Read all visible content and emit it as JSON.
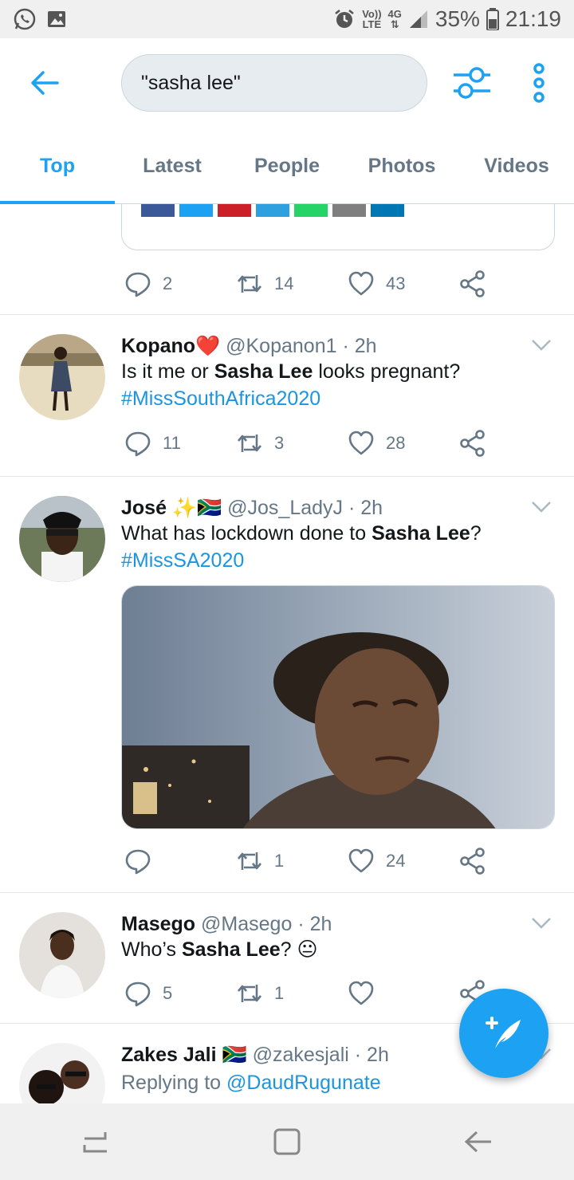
{
  "status_bar": {
    "network_top": "Vo))",
    "network_bottom": "LTE",
    "signal_type": "4G",
    "battery": "35%",
    "time": "21:19"
  },
  "search": {
    "query": "\"sasha lee\""
  },
  "tabs": [
    {
      "label": "Top",
      "active": true
    },
    {
      "label": "Latest",
      "active": false
    },
    {
      "label": "People",
      "active": false
    },
    {
      "label": "Photos",
      "active": false
    },
    {
      "label": "Videos",
      "active": false
    }
  ],
  "tweets": [
    {
      "replies": "2",
      "retweets": "14",
      "likes": "43"
    },
    {
      "name": "Kopano❤️",
      "handle": "@Kopanon1",
      "time": "· 2h",
      "text_before": "Is it me or ",
      "text_bold": "Sasha Lee",
      "text_after": " looks pregnant?",
      "hashtag": "#MissSouthAfrica2020",
      "replies": "11",
      "retweets": "3",
      "likes": "28"
    },
    {
      "name": "José ✨🇿🇦",
      "handle": "@Jos_LadyJ",
      "time": "· 2h",
      "text_before": "What has lockdown done to ",
      "text_bold": "Sasha Lee",
      "text_after": "?",
      "hashtag": "#MissSA2020",
      "replies": "",
      "retweets": "1",
      "likes": "24"
    },
    {
      "name": "Masego",
      "handle": "@Masego",
      "time": "· 2h",
      "text_before": "Who’s ",
      "text_bold": "Sasha Lee",
      "text_after": "? 😐",
      "replies": "5",
      "retweets": "1",
      "likes": ""
    },
    {
      "name": "Zakes Jali 🇿🇦",
      "handle": "@zakesjali",
      "time": "· 2h",
      "replying_prefix": "Replying to ",
      "replying_to": "@DaudRugunate"
    }
  ],
  "colors": {
    "accent": "#1da1f2",
    "hashtag": "#1b95e0",
    "muted": "#657786",
    "text": "#14171a"
  },
  "icons": [
    "back-arrow-icon",
    "filter-icon",
    "more-vertical-icon",
    "reply-icon",
    "retweet-icon",
    "like-icon",
    "share-icon",
    "chevron-down-icon",
    "compose-tweet-icon",
    "recent-apps-icon",
    "home-icon",
    "back-nav-icon"
  ]
}
